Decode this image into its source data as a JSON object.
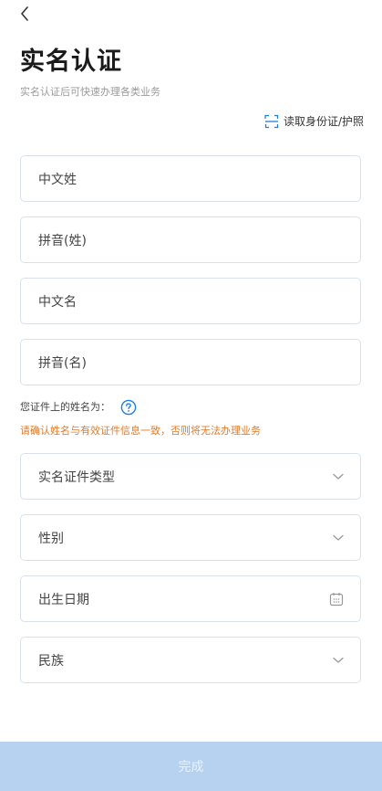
{
  "header": {
    "title": "实名认证",
    "subtitle": "实名认证后可快速办理各类业务"
  },
  "scan": {
    "label": "读取身份证/护照",
    "icon": "id-scan-icon"
  },
  "fields": {
    "chinese_surname": {
      "placeholder": "中文姓"
    },
    "pinyin_surname": {
      "placeholder": "拼音(姓)"
    },
    "chinese_given_name": {
      "placeholder": "中文名"
    },
    "pinyin_given_name": {
      "placeholder": "拼音(名)"
    },
    "id_type": {
      "placeholder": "实名证件类型"
    },
    "gender": {
      "placeholder": "性别"
    },
    "birth_date": {
      "placeholder": "出生日期"
    },
    "ethnicity": {
      "placeholder": "民族"
    }
  },
  "hint": {
    "label": "您证件上的姓名为：",
    "warning": "请确认姓名与有效证件信息一致，否则将无法办理业务"
  },
  "footer": {
    "submit_label": "完成"
  },
  "colors": {
    "accent": "#1e7fe0",
    "warning": "#e07b2b",
    "submit_bg": "#b7d2f1",
    "border": "#d9e2ec"
  }
}
